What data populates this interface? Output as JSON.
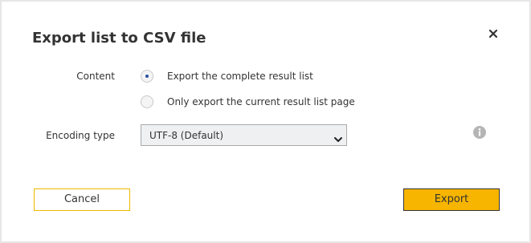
{
  "dialog": {
    "title": "Export list to CSV file",
    "close_icon": "close-icon"
  },
  "content": {
    "label": "Content",
    "options": [
      {
        "label": "Export the complete result list",
        "selected": true
      },
      {
        "label": "Only export the current result list page",
        "selected": false
      }
    ]
  },
  "encoding": {
    "label": "Encoding type",
    "selected_value": "UTF-8 (Default)",
    "info_icon": "info-icon"
  },
  "buttons": {
    "cancel_label": "Cancel",
    "export_label": "Export"
  },
  "colors": {
    "accent": "#f7b500",
    "radio_dot": "#2a4fa5",
    "text": "#333333"
  }
}
